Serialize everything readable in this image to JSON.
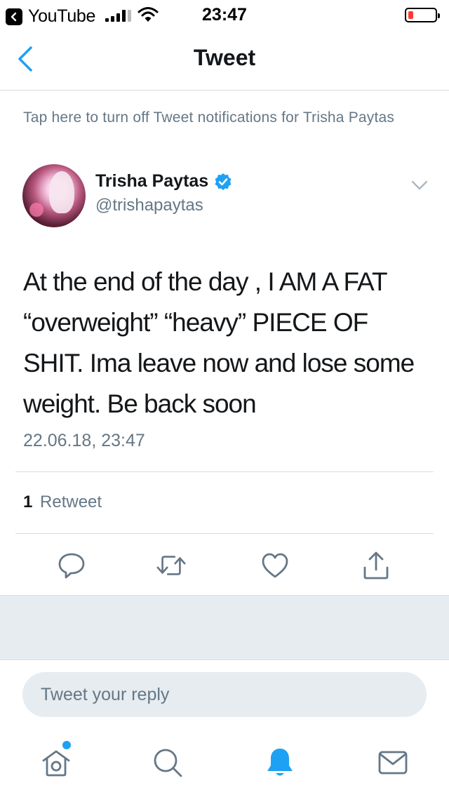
{
  "status_bar": {
    "back_app": "YouTube",
    "time": "23:47"
  },
  "nav": {
    "title": "Tweet"
  },
  "notification_banner": "Tap here to turn off Tweet notifications for Trisha Paytas",
  "tweet": {
    "author_name": "Trisha Paytas",
    "author_handle": "@trishapaytas",
    "text": "At the end of the day , I AM A FAT “overweight” “heavy” PIECE OF SHIT. Ima leave now and lose some weight. Be back soon",
    "timestamp": "22.06.18, 23:47",
    "retweet_count": "1",
    "retweet_label": "Retweet"
  },
  "reply": {
    "placeholder": "Tweet your reply"
  },
  "colors": {
    "accent": "#1da1f2",
    "muted_text": "#657786",
    "divider": "#d8dde1",
    "background_gray": "#e6ecf0",
    "battery_low": "#ff3b30"
  },
  "icons": {
    "back": "chevron-left-icon",
    "verified": "verified-badge-icon",
    "more": "chevron-down-icon",
    "reply": "reply-bubble-icon",
    "retweet": "retweet-icon",
    "like": "heart-icon",
    "share": "share-icon",
    "home": "home-icon",
    "search": "search-icon",
    "notifications": "bell-icon",
    "messages": "envelope-icon"
  },
  "battery_level": 0.2
}
